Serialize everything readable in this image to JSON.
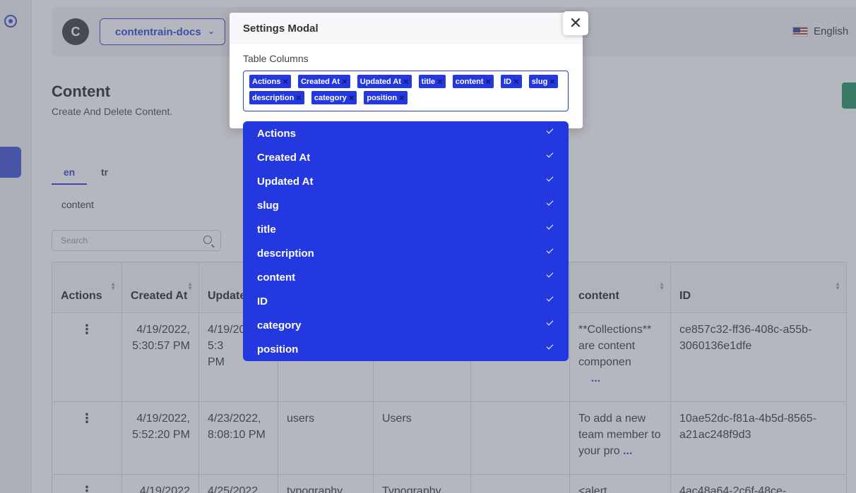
{
  "topbar": {
    "avatar_letter": "C",
    "project": "contentrain-docs",
    "language": "English"
  },
  "page": {
    "title": "Content",
    "subtitle": "Create And Delete Content."
  },
  "tabs": [
    "en",
    "tr"
  ],
  "subtab": "content",
  "search": {
    "placeholder": "Search"
  },
  "table": {
    "headers": [
      "Actions",
      "Created At",
      "Updated At",
      "",
      "",
      "",
      "content",
      "ID"
    ],
    "rows": [
      {
        "created": "4/19/2022, 5:30:57 PM",
        "updated": "4/19/2022, 5:3",
        "updated_tail": "PM",
        "slug": "",
        "title": "",
        "description": "",
        "content": "**Collections** are content componen",
        "content_more": "...",
        "id": "ce857c32-ff36-408c-a55b-3060136e1dfe"
      },
      {
        "created": "4/19/2022, 5:52:20 PM",
        "updated": "4/23/2022, 8:08:10 PM",
        "slug": "users",
        "title": "Users",
        "description": "",
        "content": "To add a new team member to your pro",
        "content_more": "...",
        "id": "10ae52dc-f81a-4b5d-8565-a21ac248f9d3"
      },
      {
        "created": "4/19/2022",
        "updated": "4/25/2022",
        "slug": "typography",
        "title": "Typography",
        "description": "",
        "content": "<alert",
        "id": "4ac48a64-2c6f-48ce-"
      }
    ]
  },
  "modal": {
    "title": "Settings Modal",
    "label": "Table Columns",
    "tags": [
      "Actions",
      "Created At",
      "Updated At",
      "title",
      "content",
      "ID",
      "slug",
      "description",
      "category",
      "position"
    ],
    "close_symbol": "✕"
  },
  "dropdown": {
    "options": [
      "Actions",
      "Created At",
      "Updated At",
      "slug",
      "title",
      "description",
      "content",
      "ID",
      "category",
      "position"
    ]
  }
}
